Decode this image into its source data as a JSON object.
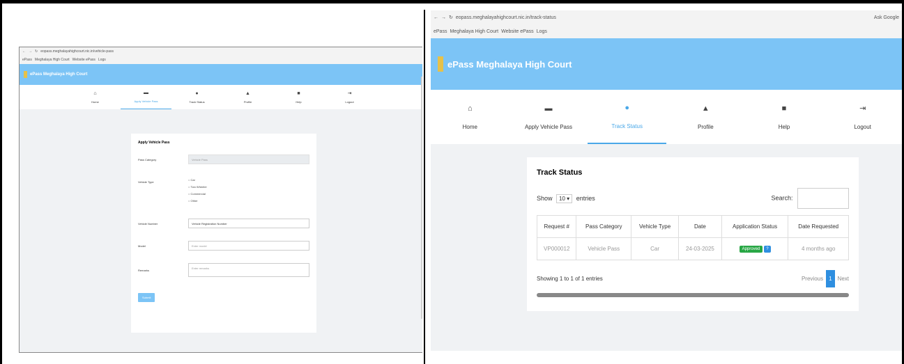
{
  "left": {
    "url": "eopass.meghalayahighcourt.nic.in/vehicle-pass",
    "bookmarks": [
      "ePass",
      "Meghalaya High Court",
      "Website ePass",
      "Logs"
    ],
    "app_title": "ePass Meghalaya High Court",
    "nav": [
      {
        "icon": "home-icon",
        "glyph": "⌂",
        "label": "Home"
      },
      {
        "icon": "car-icon",
        "glyph": "▬",
        "label": "Apply Vehicle Pass"
      },
      {
        "icon": "pin-icon",
        "glyph": "●",
        "label": "Track Status"
      },
      {
        "icon": "user-icon",
        "glyph": "▲",
        "label": "Profile"
      },
      {
        "icon": "book-icon",
        "glyph": "■",
        "label": "Help"
      },
      {
        "icon": "logout-icon",
        "glyph": "⇥",
        "label": "Logout"
      }
    ],
    "form": {
      "title": "Apply Vehicle Pass",
      "pass_category_label": "Pass Category",
      "pass_category_value": "Vehicle Pass",
      "vehicle_type_label": "Vehicle Type",
      "vehicle_options": [
        "Car",
        "Two Wheeler",
        "Commercial",
        "Other"
      ],
      "vehicle_no_label": "Vehicle Number",
      "vehicle_no_value": "Vehicle Registration Number",
      "model_label": "Model",
      "model_placeholder": "Enter model",
      "remarks_label": "Remarks",
      "remarks_placeholder": "Enter remarks",
      "submit_label": "Submit"
    }
  },
  "right": {
    "url": "eopass.meghalayahighcourt.nic.in/track-status",
    "bookmarks": [
      "ePass",
      "Meghalaya High Court",
      "Website ePass",
      "Logs"
    ],
    "profile_label": "Ask Google",
    "app_title": "ePass Meghalaya High Court",
    "nav": [
      {
        "icon": "home-icon",
        "glyph": "⌂",
        "label": "Home"
      },
      {
        "icon": "car-icon",
        "glyph": "▬",
        "label": "Apply Vehicle Pass"
      },
      {
        "icon": "pin-icon",
        "glyph": "●",
        "label": "Track Status"
      },
      {
        "icon": "user-icon",
        "glyph": "▲",
        "label": "Profile"
      },
      {
        "icon": "book-icon",
        "glyph": "■",
        "label": "Help"
      },
      {
        "icon": "logout-icon",
        "glyph": "⇥",
        "label": "Logout"
      }
    ],
    "active_tab": 2,
    "card": {
      "title": "Track Status",
      "show_label": "Show",
      "entries_value": "10",
      "entries_label": "entries",
      "search_label": "Search:",
      "columns": [
        "Request #",
        "Pass Category",
        "Vehicle Type",
        "Date",
        "Application Status",
        "Date Requested"
      ],
      "rows": [
        {
          "request": "VP000012",
          "category": "Vehicle Pass",
          "type": "Car",
          "date": "24-03-2025",
          "status": "Approved",
          "requested": "4 months ago"
        }
      ],
      "info": "Showing 1 to 1 of 1 entries",
      "prev_label": "Previous",
      "page": "1",
      "next_label": "Next"
    }
  }
}
